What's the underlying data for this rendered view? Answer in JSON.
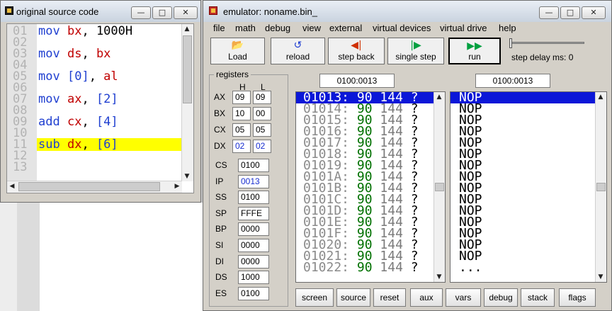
{
  "source_window": {
    "title": "original source code",
    "line_numbers": [
      "01",
      "02",
      "03",
      "04",
      "05",
      "06",
      "07",
      "08",
      "09",
      "10",
      "11",
      "12",
      "13"
    ],
    "lines": [
      {
        "op": "mov",
        "a": "bx",
        "sep": ", ",
        "b": "1000H"
      },
      {
        "op": "mov",
        "a": "ds",
        "sep": ", ",
        "b": "bx"
      },
      {
        "op": "mov",
        "a": "[0]",
        "sep": ", ",
        "b": "al"
      },
      {
        "op": "mov",
        "a": "ax",
        "sep": ", ",
        "b": "[2]"
      },
      {
        "op": "add",
        "a": "cx",
        "sep": ", ",
        "b": "[4]"
      },
      {
        "op": "sub",
        "a": "dx",
        "sep": ", ",
        "b": "[6]"
      }
    ]
  },
  "emulator_window": {
    "title": "emulator: noname.bin_",
    "menu": [
      "file",
      "math",
      "debug",
      "view",
      "external",
      "virtual devices",
      "virtual drive",
      "help"
    ],
    "toolbar": {
      "load": "Load",
      "reload": "reload",
      "step_back": "step back",
      "single_step": "single step",
      "run": "run",
      "step_delay": "step delay ms: 0"
    },
    "registers_title": "registers",
    "col_h": "H",
    "col_l": "L",
    "gp": [
      {
        "name": "AX",
        "h": "09",
        "l": "09"
      },
      {
        "name": "BX",
        "h": "10",
        "l": "00"
      },
      {
        "name": "CX",
        "h": "05",
        "l": "05"
      },
      {
        "name": "DX",
        "h": "02",
        "l": "02"
      }
    ],
    "seg": [
      {
        "name": "CS",
        "val": "0100"
      },
      {
        "name": "IP",
        "val": "0013"
      },
      {
        "name": "SS",
        "val": "0100"
      },
      {
        "name": "SP",
        "val": "FFFE"
      },
      {
        "name": "BP",
        "val": "0000"
      },
      {
        "name": "SI",
        "val": "0000"
      },
      {
        "name": "DI",
        "val": "0000"
      },
      {
        "name": "DS",
        "val": "1000"
      },
      {
        "name": "ES",
        "val": "0100"
      }
    ],
    "addr_left": "0100:0013",
    "addr_right": "0100:0013",
    "memory": [
      {
        "addr": "01013:",
        "hex": "90",
        "dec": "144",
        "ch": "?"
      },
      {
        "addr": "01014:",
        "hex": "90",
        "dec": "144",
        "ch": "?"
      },
      {
        "addr": "01015:",
        "hex": "90",
        "dec": "144",
        "ch": "?"
      },
      {
        "addr": "01016:",
        "hex": "90",
        "dec": "144",
        "ch": "?"
      },
      {
        "addr": "01017:",
        "hex": "90",
        "dec": "144",
        "ch": "?"
      },
      {
        "addr": "01018:",
        "hex": "90",
        "dec": "144",
        "ch": "?"
      },
      {
        "addr": "01019:",
        "hex": "90",
        "dec": "144",
        "ch": "?"
      },
      {
        "addr": "0101A:",
        "hex": "90",
        "dec": "144",
        "ch": "?"
      },
      {
        "addr": "0101B:",
        "hex": "90",
        "dec": "144",
        "ch": "?"
      },
      {
        "addr": "0101C:",
        "hex": "90",
        "dec": "144",
        "ch": "?"
      },
      {
        "addr": "0101D:",
        "hex": "90",
        "dec": "144",
        "ch": "?"
      },
      {
        "addr": "0101E:",
        "hex": "90",
        "dec": "144",
        "ch": "?"
      },
      {
        "addr": "0101F:",
        "hex": "90",
        "dec": "144",
        "ch": "?"
      },
      {
        "addr": "01020:",
        "hex": "90",
        "dec": "144",
        "ch": "?"
      },
      {
        "addr": "01021:",
        "hex": "90",
        "dec": "144",
        "ch": "?"
      },
      {
        "addr": "01022:",
        "hex": "90",
        "dec": "144",
        "ch": "?"
      }
    ],
    "disasm": [
      "NOP",
      "NOP",
      "NOP",
      "NOP",
      "NOP",
      "NOP",
      "NOP",
      "NOP",
      "NOP",
      "NOP",
      "NOP",
      "NOP",
      "NOP",
      "NOP",
      "NOP",
      "..."
    ],
    "bottom_buttons": [
      "screen",
      "source",
      "reset",
      "aux",
      "vars",
      "debug",
      "stack",
      "flags"
    ]
  }
}
